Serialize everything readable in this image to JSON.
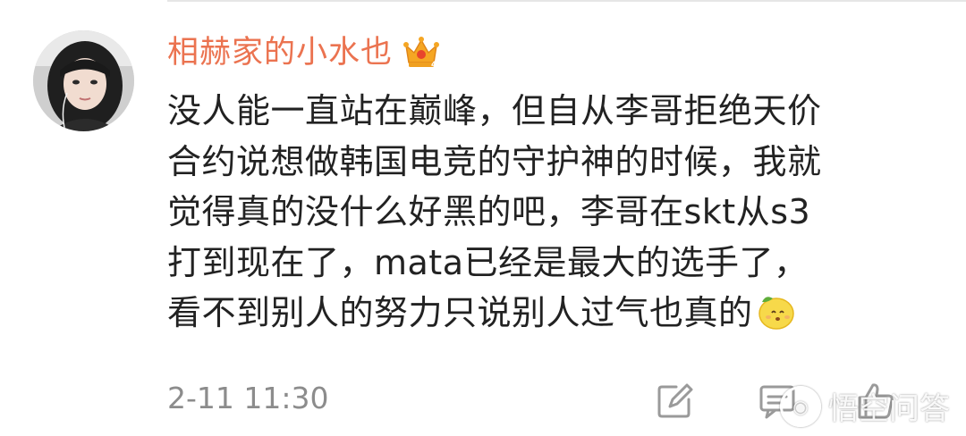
{
  "comment": {
    "username": "相赫家的小水也",
    "lines": [
      "没人能一直站在巅峰，但自从李哥拒绝天价",
      "合约说想做韩国电竞的守护神的时候，我就",
      "觉得真的没什么好黑的吧，李哥在skt从s3",
      "打到现在了，mata已经是最大的选手了，",
      "看不到别人的努力只说别人过气也真的"
    ],
    "timestamp": "2-11 11:30"
  },
  "icons": {
    "badge": "crown-icon",
    "emoji": "lemon-face-emoji-icon",
    "actions": [
      "edit-icon",
      "reply-icon",
      "like-icon"
    ]
  },
  "colors": {
    "username": "#eb7350",
    "text": "#222222",
    "timestamp": "#8c8c8c",
    "crown": "#f5a623"
  },
  "watermark": {
    "text": "悟空问答"
  }
}
